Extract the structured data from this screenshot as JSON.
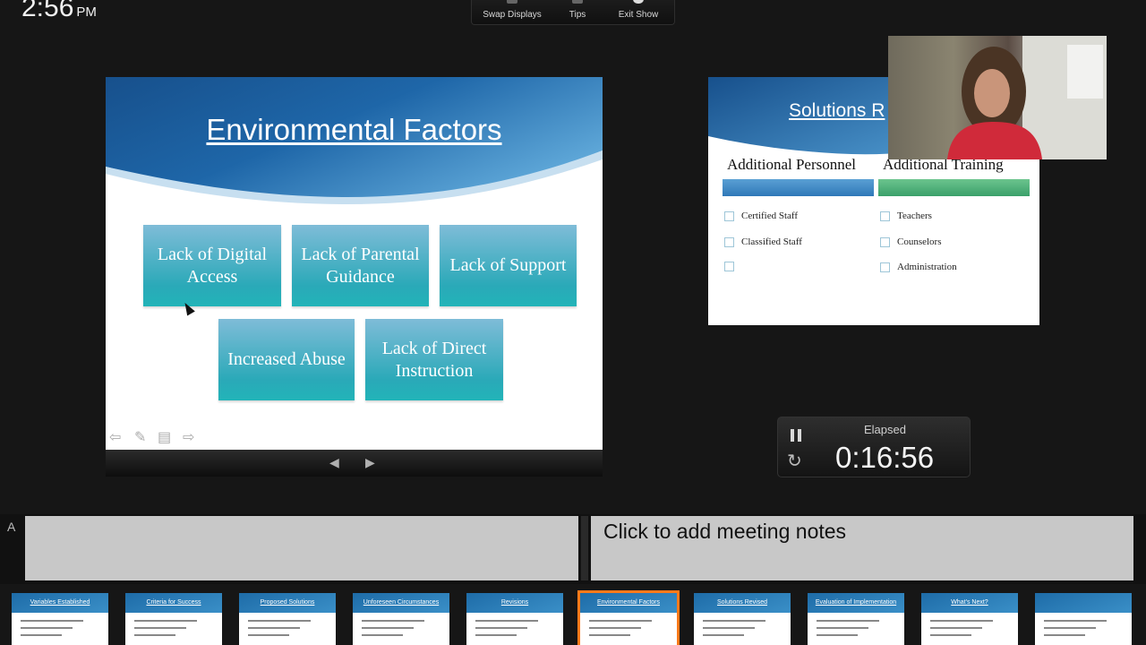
{
  "clock": {
    "time": "2:56",
    "ampm": "PM"
  },
  "toolbar": {
    "swap": "Swap Displays",
    "tips": "Tips",
    "exit": "Exit Show"
  },
  "current_slide": {
    "title": "Environmental Factors",
    "boxes": [
      "Lack of Digital Access",
      "Lack of Parental Guidance",
      "Lack of Support",
      "Increased Abuse",
      "Lack of Direct Instruction"
    ]
  },
  "next_slide": {
    "title_partial": "Solutions R",
    "col1_head": "Additional Personnel",
    "col2_head": "Additional Training",
    "col1_items": [
      "Certified Staff",
      "Classified Staff",
      ""
    ],
    "col2_items": [
      "Teachers",
      "Counselors",
      "Administration"
    ],
    "colors": {
      "col1_bar": "#2f78b8",
      "col2_bar": "#3aa06a"
    }
  },
  "timer": {
    "label": "Elapsed",
    "value": "0:16:56"
  },
  "notes": {
    "placeholder": "Click to add meeting notes",
    "font_button": "A"
  },
  "filmstrip": [
    "Variables Established",
    "Criteria for Success",
    "Proposed Solutions",
    "Unforeseen Circumstances",
    "Revisions",
    "Environmental Factors",
    "Solutions Revised",
    "Evaluation of Implementation",
    "What's Next?",
    ""
  ],
  "filmstrip_selected": 5,
  "colors": {
    "accent": "#ff7a1a",
    "slide_blue": "#1d5d9e",
    "box_teal": "#2aa9b8"
  },
  "icons": {
    "pause": "pause-icon",
    "reset": "reset-icon",
    "pen": "pen-icon",
    "prev": "left-arrow-icon",
    "next": "right-arrow-icon"
  }
}
